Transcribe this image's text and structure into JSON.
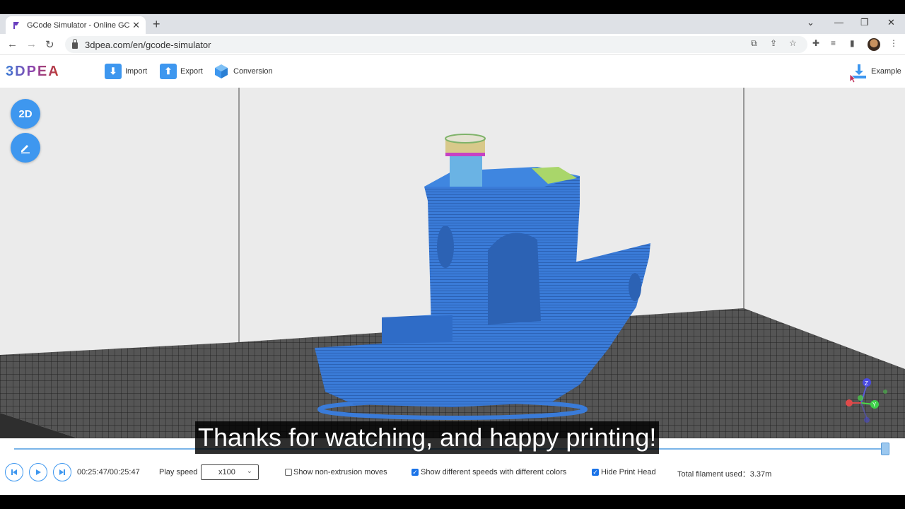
{
  "browser": {
    "tab_title": "GCode Simulator - Online GC",
    "new_tab_icon": "+",
    "url": "3dpea.com/en/gcode-simulator"
  },
  "app": {
    "logo": "3DPEA",
    "toolbar": {
      "import_label": "Import",
      "export_label": "Export",
      "conversion_label": "Conversion",
      "example_label": "Example"
    },
    "view_buttons": {
      "mode_2d_label": "2D"
    }
  },
  "playback": {
    "time": "00:25:47/00:25:47",
    "progress": 1.0,
    "play_speed_label": "Play speed",
    "play_speed_value": "x100",
    "options": [
      {
        "label": "Show non-extrusion moves",
        "checked": false
      },
      {
        "label": "Show different speeds with different colors",
        "checked": true
      },
      {
        "label": "Hide Print Head",
        "checked": true
      }
    ],
    "filament_label": "Total filament used：3.37m"
  },
  "subtitle": "Thanks for watching, and happy printing!",
  "colors": {
    "accent": "#3e97ef",
    "model_blue": "#3a7bd8",
    "bed_grid": "#4a4a4a",
    "viewport_bg": "#ebebeb"
  }
}
